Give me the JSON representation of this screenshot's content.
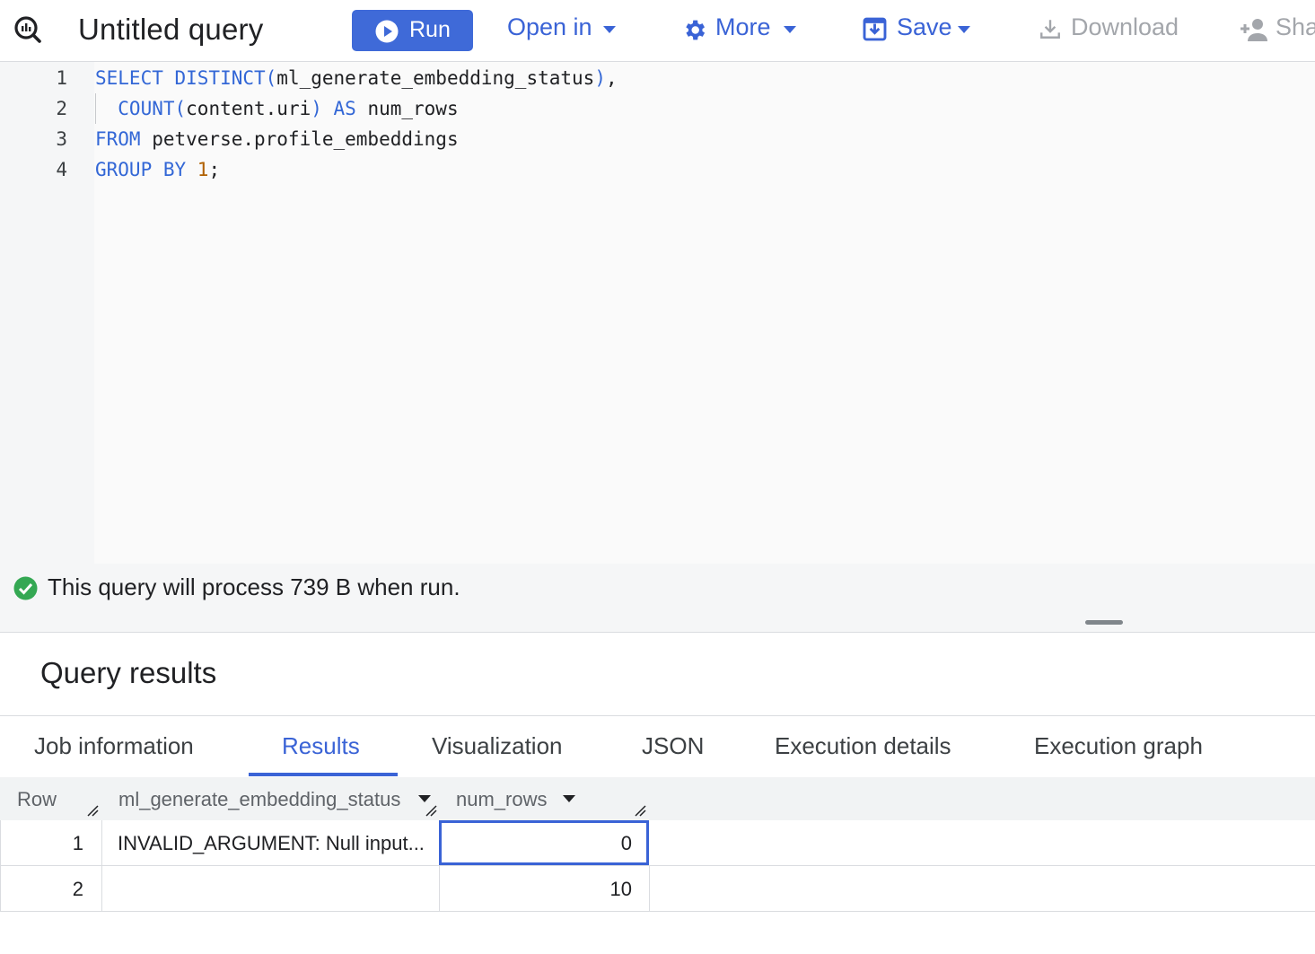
{
  "toolbar": {
    "title": "Untitled query",
    "run_label": "Run",
    "open_in_label": "Open in",
    "more_label": "More",
    "save_label": "Save",
    "download_label": "Download",
    "share_label": "Sha"
  },
  "editor": {
    "line_numbers": [
      "1",
      "2",
      "3",
      "4"
    ],
    "lines": [
      [
        {
          "t": "SELECT DISTINCT(",
          "c": "kw"
        },
        {
          "t": "ml_generate_embedding_status",
          "c": ""
        },
        {
          "t": ")",
          "c": "kw"
        },
        {
          "t": ",",
          "c": ""
        }
      ],
      [
        {
          "t": "  COUNT(",
          "c": "kw"
        },
        {
          "t": "content.uri",
          "c": ""
        },
        {
          "t": ") AS ",
          "c": "kw"
        },
        {
          "t": "num_rows",
          "c": ""
        }
      ],
      [
        {
          "t": "FROM ",
          "c": "kw"
        },
        {
          "t": "petverse.profile_embeddings",
          "c": ""
        }
      ],
      [
        {
          "t": "GROUP BY ",
          "c": "kw"
        },
        {
          "t": "1",
          "c": "num"
        },
        {
          "t": ";",
          "c": ""
        }
      ]
    ]
  },
  "status": {
    "message": "This query will process 739 B when run."
  },
  "results": {
    "title": "Query results",
    "tabs": [
      "Job information",
      "Results",
      "Visualization",
      "JSON",
      "Execution details",
      "Execution graph"
    ],
    "active_tab": "Results",
    "columns": [
      "Row",
      "ml_generate_embedding_status",
      "num_rows"
    ],
    "rows": [
      {
        "row": "1",
        "status": "INVALID_ARGUMENT: Null input...",
        "num_rows": "0"
      },
      {
        "row": "2",
        "status": "",
        "num_rows": "10"
      }
    ]
  },
  "colors": {
    "accent": "#3a63d6",
    "run_button": "#3f6ad8",
    "success": "#34a853",
    "keyword": "#3367d6",
    "number": "#b06000"
  }
}
